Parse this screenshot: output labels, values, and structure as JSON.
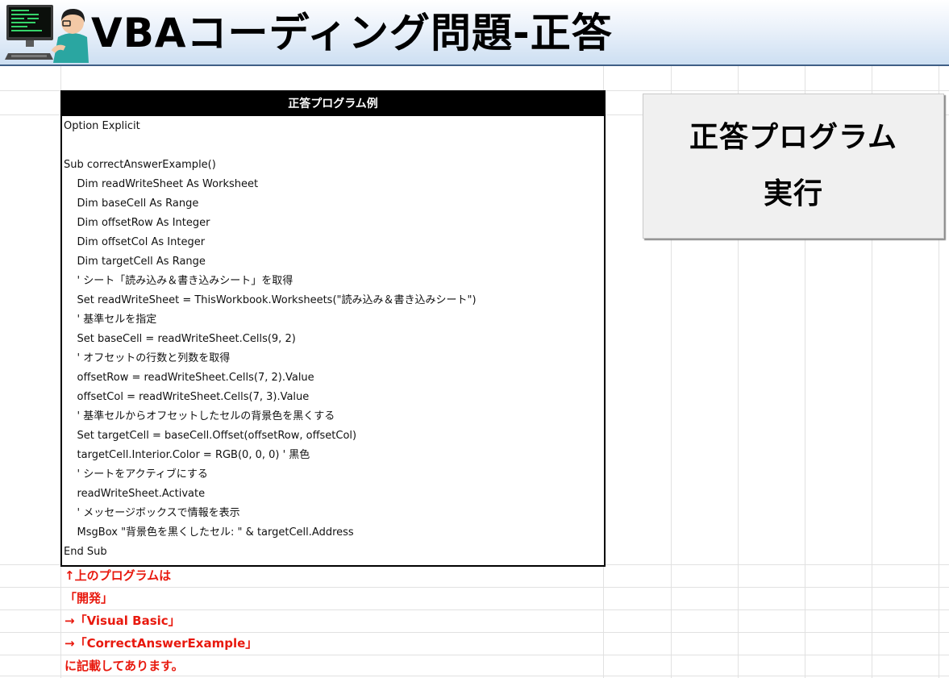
{
  "header": {
    "title": "VBAコーディング問題-正答",
    "avatar_icon": "programmer-at-computer-icon"
  },
  "code_box": {
    "heading": "正答プログラム例",
    "lines": [
      "Option Explicit",
      "",
      "Sub correctAnswerExample()",
      "    Dim readWriteSheet As Worksheet",
      "    Dim baseCell As Range",
      "    Dim offsetRow As Integer",
      "    Dim offsetCol As Integer",
      "    Dim targetCell As Range",
      "    ' シート「読み込み＆書き込みシート」を取得",
      "    Set readWriteSheet = ThisWorkbook.Worksheets(\"読み込み＆書き込みシート\")",
      "    ' 基準セルを指定",
      "    Set baseCell = readWriteSheet.Cells(9, 2)",
      "    ' オフセットの行数と列数を取得",
      "    offsetRow = readWriteSheet.Cells(7, 2).Value",
      "    offsetCol = readWriteSheet.Cells(7, 3).Value",
      "    ' 基準セルからオフセットしたセルの背景色を黒くする",
      "    Set targetCell = baseCell.Offset(offsetRow, offsetCol)",
      "    targetCell.Interior.Color = RGB(0, 0, 0) ' 黒色",
      "    ' シートをアクティブにする",
      "    readWriteSheet.Activate",
      "    ' メッセージボックスで情報を表示",
      "    MsgBox \"背景色を黒くしたセル: \" & targetCell.Address",
      "End Sub"
    ]
  },
  "run_button": {
    "line1": "正答プログラム",
    "line2": "実行"
  },
  "note": {
    "lines": [
      "↑上のプログラムは",
      "「開発」",
      "→「Visual Basic」",
      "→「CorrectAnswerExample」",
      "に記載してあります。"
    ],
    "color": "#e8190e"
  }
}
